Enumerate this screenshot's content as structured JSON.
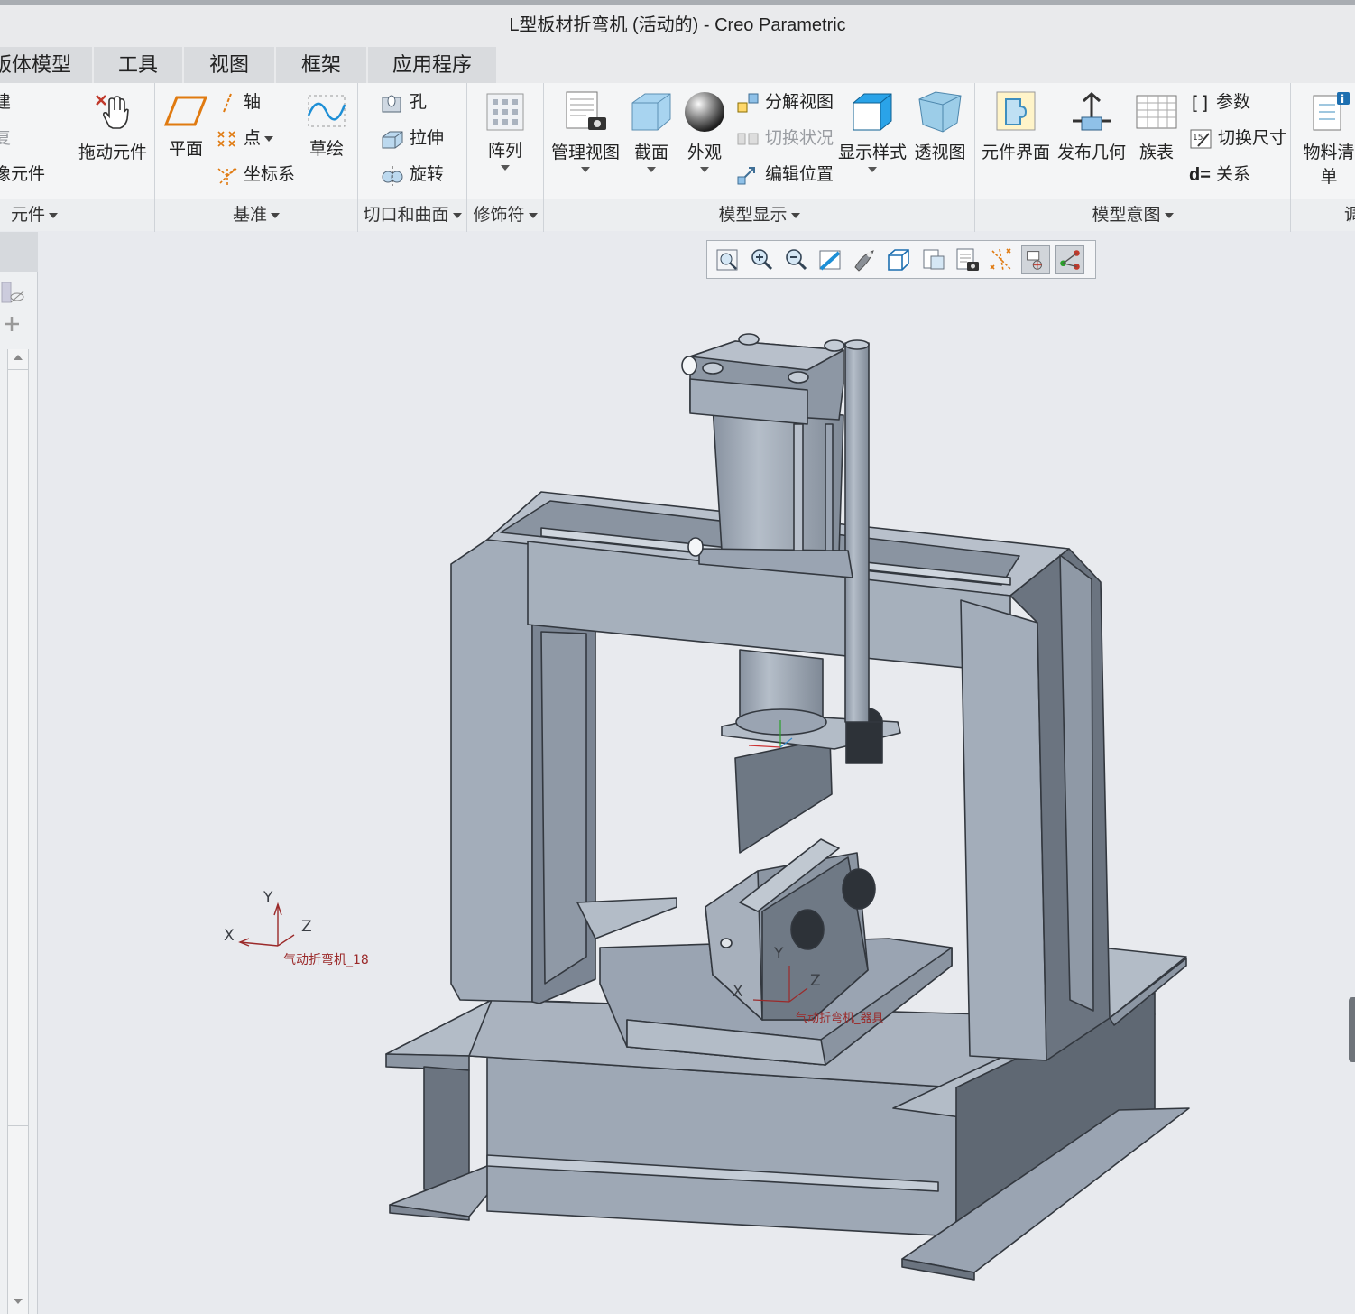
{
  "window": {
    "title": "L型板材折弯机 (活动的) - Creo Parametric"
  },
  "tabs": [
    {
      "label": "钣体模型"
    },
    {
      "label": "工具"
    },
    {
      "label": "视图"
    },
    {
      "label": "框架"
    },
    {
      "label": "应用程序"
    }
  ],
  "ribbon": {
    "component": {
      "create": "创建",
      "repeat": "重复",
      "mirror": "镜像元件",
      "drag": "拖动元件",
      "group": "元件"
    },
    "datum": {
      "plane": "平面",
      "axis": "轴",
      "point": "点",
      "csys": "坐标系",
      "sketch": "草绘",
      "group": "基准"
    },
    "cut_surface": {
      "hole": "孔",
      "extrude": "拉伸",
      "revolve": "旋转",
      "group": "切口和曲面"
    },
    "modifier": {
      "pattern": "阵列",
      "group": "修饰符"
    },
    "model_display": {
      "manage_views": "管理视图",
      "section": "截面",
      "appearance": "外观",
      "explode": "分解视图",
      "toggle_state": "切换状况",
      "edit_position": "编辑位置",
      "display_style": "显示样式",
      "perspective": "透视图",
      "group": "模型显示"
    },
    "model_intent": {
      "component_interface": "元件界面",
      "publish_geometry": "发布几何",
      "family_table": "族表",
      "parameters": "参数",
      "toggle_dimensions": "切换尺寸",
      "relations": "关系",
      "group": "模型意图"
    },
    "bom": {
      "bill_of_materials": "物料清单",
      "group": "调"
    }
  },
  "model": {
    "csys_label_left": "气动折弯机_18",
    "csys_label_center": "气动折弯机_器具",
    "axis_x": "X",
    "axis_y": "Y",
    "axis_z": "Z"
  },
  "colors": {
    "steel": "#9aa4b2",
    "steel_dark": "#5f6873",
    "steel_light": "#b3bcc7",
    "canvas": "#e8eaee",
    "csys_red": "#9b2a2a"
  }
}
